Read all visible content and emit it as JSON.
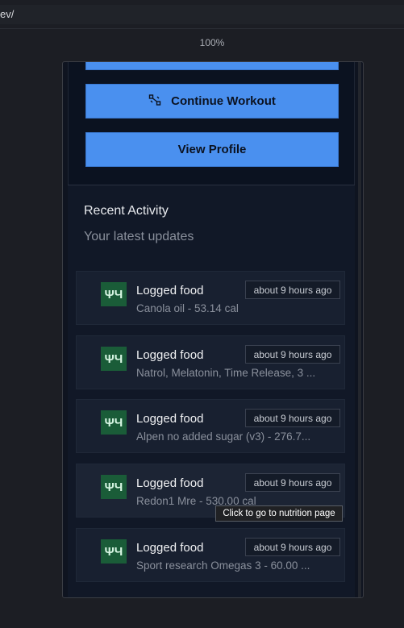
{
  "browser": {
    "url": "ev/",
    "zoom": "100%"
  },
  "actions": {
    "continue_workout_label": "Continue Workout",
    "view_profile_label": "View Profile"
  },
  "activity": {
    "title": "Recent Activity",
    "subtitle": "Your latest updates",
    "items": [
      {
        "title": "Logged food",
        "description": "Canola oil - 53.14 cal",
        "time": "about 9 hours ago",
        "icon": "utensils-icon"
      },
      {
        "title": "Logged food",
        "description": "Natrol, Melatonin, Time Release, 3 ...",
        "time": "about 9 hours ago",
        "icon": "utensils-icon"
      },
      {
        "title": "Logged food",
        "description": "Alpen no added sugar (v3) - 276.7...",
        "time": "about 9 hours ago",
        "icon": "utensils-icon"
      },
      {
        "title": "Logged food",
        "description": "Redon1 Mre - 530.00 cal",
        "time": "about 9 hours ago",
        "icon": "utensils-icon"
      },
      {
        "title": "Logged food",
        "description": "Sport research Omegas 3 - 60.00 ...",
        "time": "about 9 hours ago",
        "icon": "utensils-icon"
      }
    ]
  },
  "tooltip": {
    "text": "Click to go to nutrition page"
  },
  "colors": {
    "primary": "#4a90ef",
    "icon_bg": "#1a5c38",
    "background": "#0f1420"
  }
}
